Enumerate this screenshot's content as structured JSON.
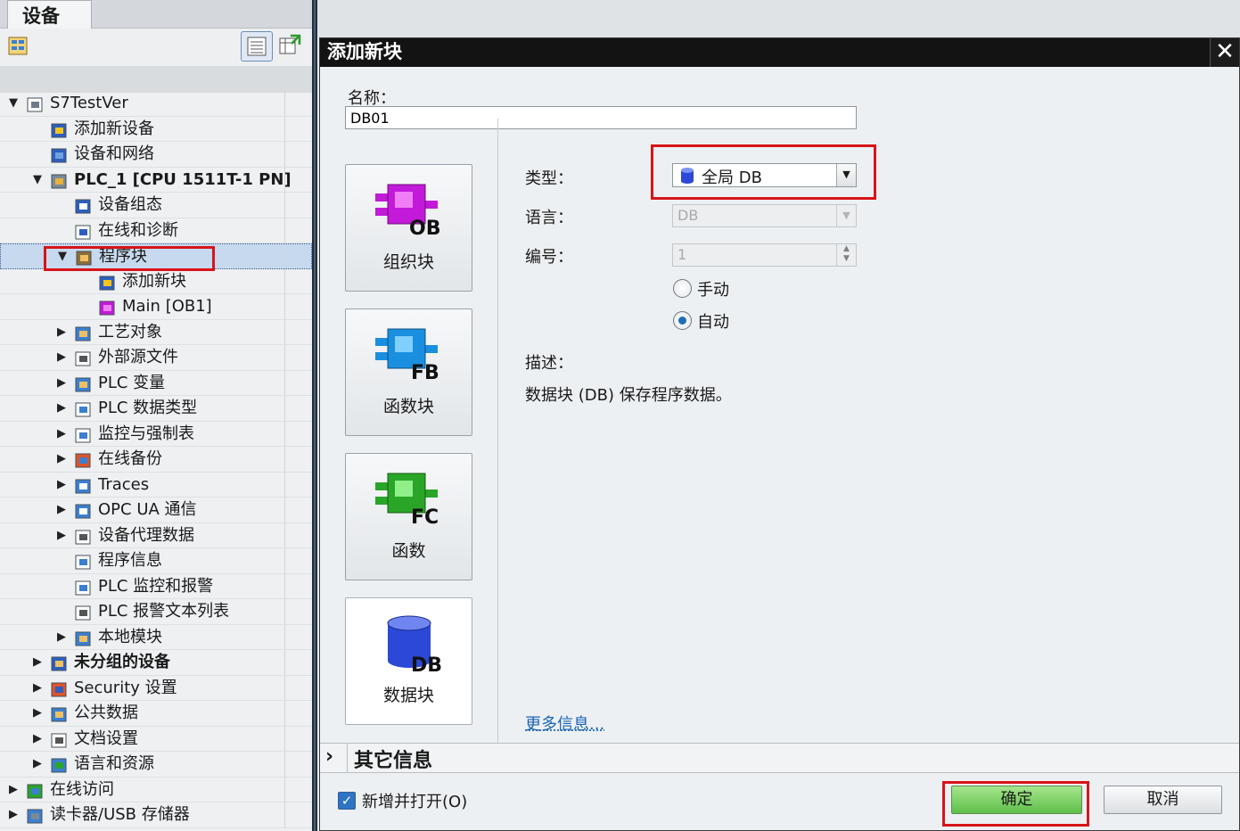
{
  "left_panel": {
    "tab_label": "设备",
    "tree": [
      {
        "label": "S7TestVer",
        "indent": 0,
        "toggle": "▼",
        "icon": "project-icon",
        "bold": false
      },
      {
        "label": "添加新设备",
        "indent": 1,
        "toggle": "",
        "icon": "add-device-icon",
        "bold": false
      },
      {
        "label": "设备和网络",
        "indent": 1,
        "toggle": "",
        "icon": "network-icon",
        "bold": false
      },
      {
        "label": "PLC_1 [CPU 1511T-1 PN]",
        "indent": 1,
        "toggle": "▼",
        "icon": "plc-icon",
        "bold": true
      },
      {
        "label": "设备组态",
        "indent": 2,
        "toggle": "",
        "icon": "device-config-icon",
        "bold": false
      },
      {
        "label": "在线和诊断",
        "indent": 2,
        "toggle": "",
        "icon": "diagnostics-icon",
        "bold": false
      },
      {
        "label": "程序块",
        "indent": 2,
        "toggle": "▼",
        "icon": "program-blocks-icon",
        "bold": false,
        "selected": true
      },
      {
        "label": "添加新块",
        "indent": 3,
        "toggle": "",
        "icon": "add-block-icon",
        "bold": false
      },
      {
        "label": "Main [OB1]",
        "indent": 3,
        "toggle": "",
        "icon": "ob-icon",
        "bold": false
      },
      {
        "label": "工艺对象",
        "indent": 2,
        "toggle": "▶",
        "icon": "technology-objects-icon",
        "bold": false
      },
      {
        "label": "外部源文件",
        "indent": 2,
        "toggle": "▶",
        "icon": "external-source-icon",
        "bold": false
      },
      {
        "label": "PLC 变量",
        "indent": 2,
        "toggle": "▶",
        "icon": "plc-tags-icon",
        "bold": false
      },
      {
        "label": "PLC 数据类型",
        "indent": 2,
        "toggle": "▶",
        "icon": "plc-datatypes-icon",
        "bold": false
      },
      {
        "label": "监控与强制表",
        "indent": 2,
        "toggle": "▶",
        "icon": "watch-table-icon",
        "bold": false
      },
      {
        "label": "在线备份",
        "indent": 2,
        "toggle": "▶",
        "icon": "online-backup-icon",
        "bold": false
      },
      {
        "label": "Traces",
        "indent": 2,
        "toggle": "▶",
        "icon": "traces-icon",
        "bold": false
      },
      {
        "label": "OPC UA 通信",
        "indent": 2,
        "toggle": "▶",
        "icon": "opcua-icon",
        "bold": false
      },
      {
        "label": "设备代理数据",
        "indent": 2,
        "toggle": "▶",
        "icon": "device-proxy-icon",
        "bold": false
      },
      {
        "label": "程序信息",
        "indent": 2,
        "toggle": "",
        "icon": "program-info-icon",
        "bold": false
      },
      {
        "label": "PLC 监控和报警",
        "indent": 2,
        "toggle": "",
        "icon": "plc-alarms-icon",
        "bold": false
      },
      {
        "label": "PLC 报警文本列表",
        "indent": 2,
        "toggle": "",
        "icon": "alarm-text-list-icon",
        "bold": false
      },
      {
        "label": "本地模块",
        "indent": 2,
        "toggle": "▶",
        "icon": "local-modules-icon",
        "bold": false
      },
      {
        "label": "未分组的设备",
        "indent": 1,
        "toggle": "▶",
        "icon": "ungrouped-devices-icon",
        "bold": true
      },
      {
        "label": "Security 设置",
        "indent": 1,
        "toggle": "▶",
        "icon": "security-icon",
        "bold": false
      },
      {
        "label": "公共数据",
        "indent": 1,
        "toggle": "▶",
        "icon": "common-data-icon",
        "bold": false
      },
      {
        "label": "文档设置",
        "indent": 1,
        "toggle": "▶",
        "icon": "document-settings-icon",
        "bold": false
      },
      {
        "label": "语言和资源",
        "indent": 1,
        "toggle": "▶",
        "icon": "languages-icon",
        "bold": false
      },
      {
        "label": "在线访问",
        "indent": 0,
        "toggle": "▶",
        "icon": "online-access-icon",
        "bold": false
      },
      {
        "label": "读卡器/USB 存储器",
        "indent": 0,
        "toggle": "▶",
        "icon": "card-reader-icon",
        "bold": false
      }
    ]
  },
  "dialog": {
    "title": "添加新块",
    "name_label": "名称：",
    "name_value": "DB01",
    "block_types": [
      {
        "code": "OB",
        "label": "组织块",
        "color": "#c21ad8"
      },
      {
        "code": "FB",
        "label": "函数块",
        "color": "#1a8fe0"
      },
      {
        "code": "FC",
        "label": "函数",
        "color": "#2aa528"
      },
      {
        "code": "DB",
        "label": "数据块",
        "color": "#2b49d6"
      }
    ],
    "type_label": "类型：",
    "type_value": "全局 DB",
    "language_label": "语言：",
    "language_value": "DB",
    "number_label": "编号：",
    "number_value": "1",
    "radio_manual": "手动",
    "radio_auto": "自动",
    "description_label": "描述：",
    "description_text": "数据块 (DB) 保存程序数据。",
    "more_info": "更多信息...",
    "other_info": "其它信息",
    "checkbox_label": "新增并打开(O)",
    "ok": "确定",
    "cancel": "取消"
  },
  "colors": {
    "highlight": "#d81418",
    "ok_green": "#5ec04a",
    "link": "#1a64b5"
  }
}
